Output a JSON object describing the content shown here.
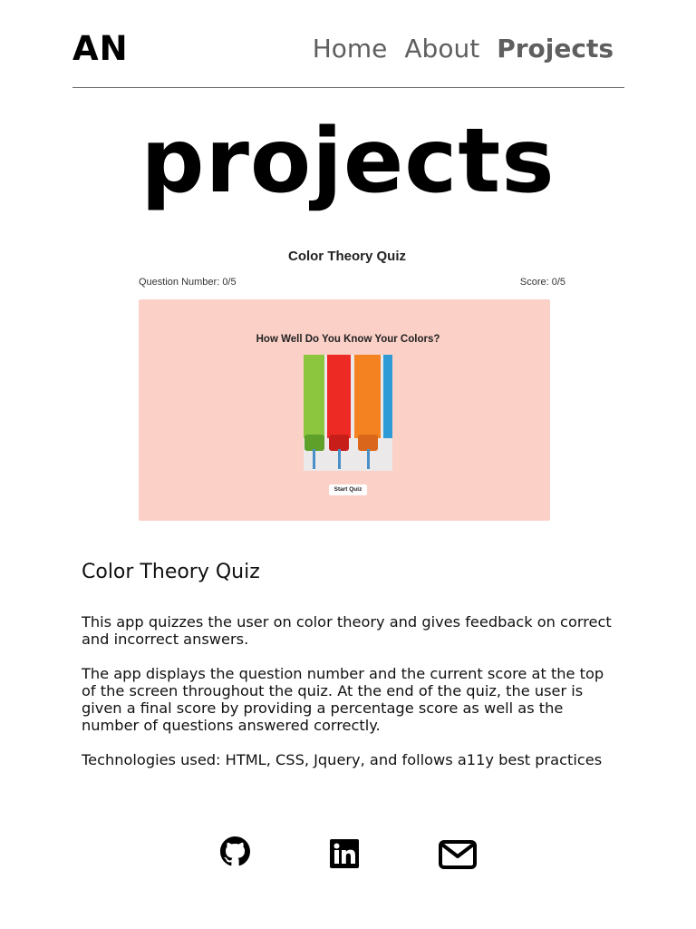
{
  "header": {
    "logo": "AN",
    "nav": [
      {
        "label": "Home",
        "active": false
      },
      {
        "label": "About",
        "active": false
      },
      {
        "label": "Projects",
        "active": true
      }
    ]
  },
  "page": {
    "title": "projects"
  },
  "project": {
    "screenshot": {
      "title": "Color Theory Quiz",
      "question_number": "Question Number: 0/5",
      "score": "Score: 0/5",
      "heading": "How Well Do You Know Your Colors?",
      "button": "Start Quiz",
      "panel_color": "#fbd0c7",
      "paint_colors": [
        "#8cc63f",
        "#ee2a24",
        "#f58220",
        "#2e9bd6"
      ]
    },
    "name": "Color Theory Quiz",
    "description": [
      "This app quizzes the user on color theory and gives feedback on correct and incorrect answers.",
      "The app displays the question number and the current score at the top of the screen throughout the quiz. At the end of the quiz, the user is given a final score by providing a percentage score as well as the number of questions answered correctly.",
      "Technologies used: HTML, CSS, Jquery, and follows a11y best practices"
    ]
  },
  "socials": [
    {
      "icon": "github-icon"
    },
    {
      "icon": "linkedin-icon"
    },
    {
      "icon": "envelope-icon"
    }
  ]
}
